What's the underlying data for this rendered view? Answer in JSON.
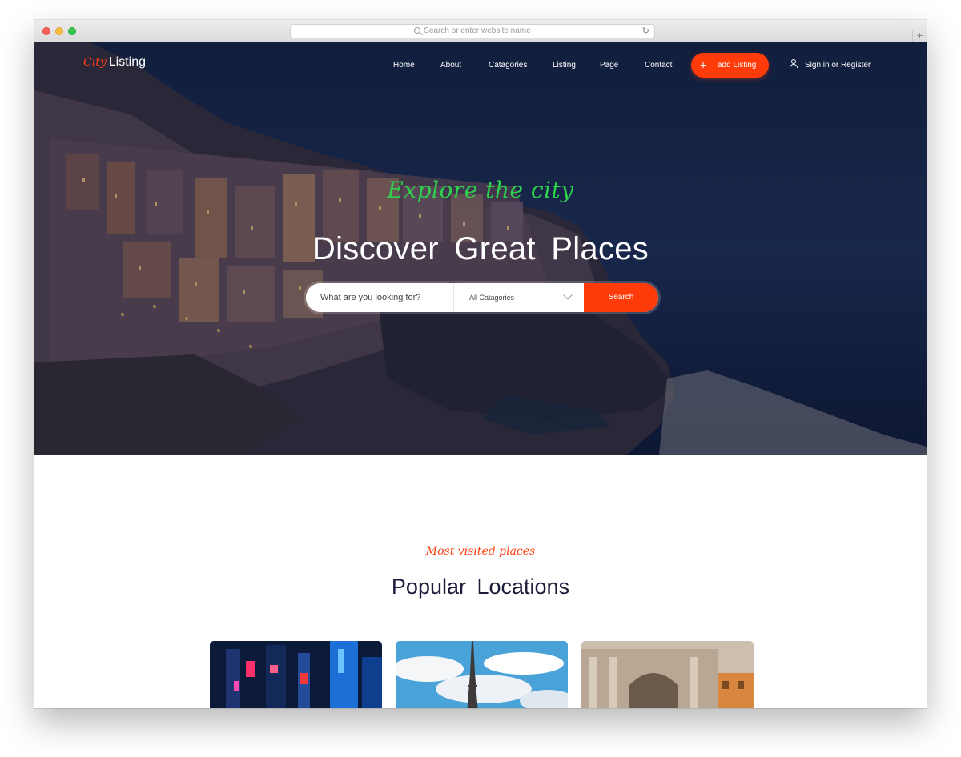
{
  "browser": {
    "url_placeholder": "Search or enter website name"
  },
  "logo": {
    "script": "City",
    "text": "Listing"
  },
  "nav": {
    "items": [
      {
        "label": "Home"
      },
      {
        "label": "About"
      },
      {
        "label": "Catagories"
      },
      {
        "label": "Listing"
      },
      {
        "label": "Page"
      },
      {
        "label": "Contact"
      }
    ],
    "add_listing": "add Listing",
    "signin": "Sign in or Register"
  },
  "hero": {
    "tagline": "Explore the city",
    "headline": "Discover Great Places",
    "search_placeholder": "What are you looking for?",
    "category_selected": "All Catagories",
    "search_button": "Search"
  },
  "popular": {
    "subtitle": "Most visited places",
    "title": "Popular Locations"
  },
  "colors": {
    "accent": "#ff3b0a",
    "tagline_green": "#2ed04e",
    "heading_dark": "#1c1c3a"
  },
  "icons": [
    "search-icon",
    "reload-icon",
    "plus-icon",
    "user-icon",
    "chevron-down-icon"
  ]
}
